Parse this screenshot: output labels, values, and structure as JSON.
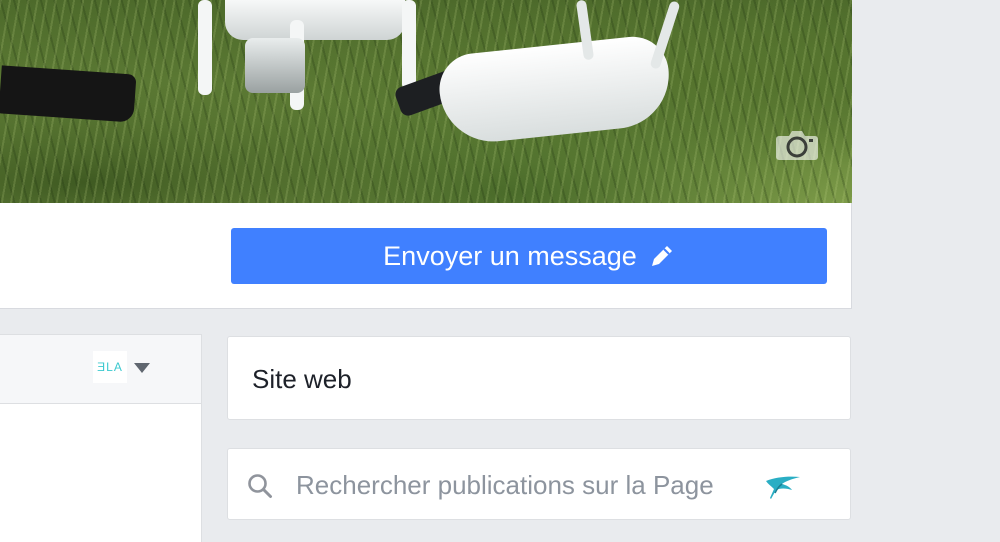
{
  "cover": {
    "camera_icon": "camera-icon"
  },
  "action_bar": {
    "send_message_label": "Envoyer un message",
    "send_message_icon": "pencil-icon",
    "button_color": "#4080ff"
  },
  "left_panel": {
    "brand_logo_text": "ƎLA",
    "dropdown_icon": "caret-down-icon"
  },
  "sidebar": {
    "website_label": "Site web",
    "search": {
      "placeholder": "Rechercher publications sur la Page",
      "value": "",
      "icon": "search-icon"
    },
    "brand_icon": "bird-logo-icon"
  },
  "colors": {
    "background": "#e9ebee",
    "accent": "#4080ff",
    "brand_teal": "#3cc9cf"
  }
}
